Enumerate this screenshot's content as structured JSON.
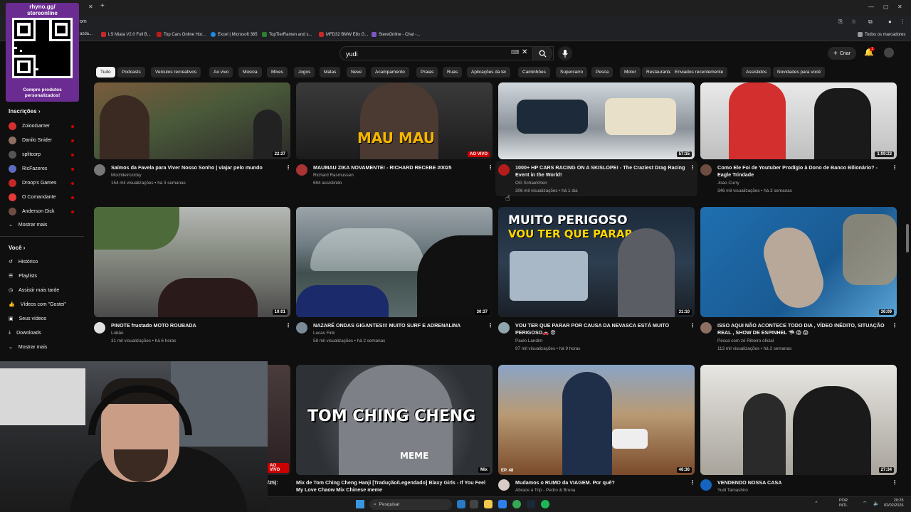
{
  "promo": {
    "line1": "rhyno.gg/",
    "line2": "stereonline",
    "cta": "Compre produtos personalizados!"
  },
  "browser": {
    "url_fragment": "om",
    "bookmarks": [
      "azda...",
      "LS Miata V2.0 Full B...",
      "Top Cars Online Hor...",
      "Excel | Microsoft 365",
      "TopTierRamen and s...",
      "MFD32 BMW E8x G...",
      "StereOnline - Chat -..."
    ],
    "all_bookmarks": "Todos os marcadores"
  },
  "header": {
    "search_value": "yudi",
    "create_label": "Criar",
    "notification_count": "1"
  },
  "chips": [
    "Tudo",
    "Podcasts",
    "Veículos recreativos",
    "Ao vivo",
    "Música",
    "Mixes",
    "Jogos",
    "Malas",
    "Neve",
    "Acampamento",
    "Praias",
    "Ruas",
    "Aplicações da lei",
    "Caminhões",
    "Supercarro",
    "Pesca",
    "Motor",
    "Restaurantes",
    "Enviados recentemente",
    "Assistidos",
    "Novidades para você"
  ],
  "sidebar": {
    "subs_heading": "Inscrições",
    "subs": [
      "ZoiooGamer",
      "Danilo Snider",
      "splitcorp",
      "RicFazeres",
      "Droop's Games",
      "O Comandante",
      "Anderson Dick"
    ],
    "show_more": "Mostrar mais",
    "you_heading": "Você",
    "you_items": [
      "Histórico",
      "Playlists",
      "Assistir mais tarde",
      "Vídeos com \"Gostei\"",
      "Seus vídeos",
      "Downloads"
    ],
    "show_more_2": "Mostrar mais"
  },
  "videos": [
    {
      "title": "Saímos da Favela para Viver Nosso Sonho | viajar  pelo mundo",
      "channel": "Mochileirozicky",
      "meta": "154 mil visualizações • há 3 semanas",
      "duration": "22:27"
    },
    {
      "title": "MAUMAU ZIKA NOVAMENTE! - RICHARD RECEBE #0025",
      "channel": "Richard Rasmussen",
      "meta": "694 assistindo",
      "duration": "AO VIVO",
      "overlay": "MAU MAU"
    },
    {
      "title": "1000+ HP CARS RACING ON A SKISLOPE! - The Craziest Drag Racing Event in the World!",
      "channel": "OG Schaefchen",
      "meta": "306 mil visualizações • há 1 dia",
      "duration": "57:15"
    },
    {
      "title": "Como Ele Foi de Youtuber Prodígio à Dono de Banco Bilionário? - Eagle Trindade",
      "channel": "Joao Curry",
      "meta": "346 mil visualizações • há 3 semanas",
      "duration": "1:09:23"
    },
    {
      "title": "PINOTE frustado MOTO ROUBADA",
      "channel": "Lobão",
      "meta": "31 mil visualizações • há 6 horas",
      "duration": "10:01"
    },
    {
      "title": "NAZARÉ ONDAS GIGANTES!!! MUITO SURF E ADRENALINA",
      "channel": "Lucas Fink",
      "meta": "58 mil visualizações • há 2 semanas",
      "duration": "30:37"
    },
    {
      "title": "VOU TER QUE PARAR POR CAUSA DA NEVASCA ESTÁ MUITO PERIGOSO🚗 😨",
      "channel": "Paulo Landim",
      "meta": "97 mil visualizações • há 9 horas",
      "duration": "31:10",
      "overlay": "MUITO PERIGOSO",
      "overlay2": "VOU TER QUE PARAR"
    },
    {
      "title": "ISSO AQUI NÃO ACONTECE TODO DIA , VÍDEO INÉDITO, SITUAÇÃO REAL , SHOW DE ESPINHEL 🦈 😱 😱",
      "channel": "Pesca com zé Ribeiro oficial",
      "meta": "113 mil visualizações • há 2 semanas",
      "duration": "36:09"
    },
    {
      "title": "/25):",
      "channel": "",
      "meta": "",
      "duration": "AO VIVO"
    },
    {
      "title": "Mix de Tom Ching Cheng Hanji [Tradução/Legendado] Blaxy Girls - If You Feel My Love Chaow Mix Chinese meme",
      "channel": "",
      "meta": "",
      "duration": "Mix",
      "overlay": "TOM CHING CHENG",
      "overlay2": "MEME"
    },
    {
      "title": "Mudamos o RUMO da VIAGEM. Por quê?",
      "channel": "Abrace a Trip - Pedro & Bruna",
      "meta": "",
      "duration": "46:36",
      "badge": "EP. 48"
    },
    {
      "title": "VENDENDO NOSSA CASA",
      "channel": "Yudi Tamashiro",
      "meta": "",
      "duration": "27:34"
    }
  ],
  "taskbar": {
    "search": "Pesquisar",
    "lang1": "POR",
    "lang2": "INTL",
    "time": "20:25",
    "date": "02/02/2026"
  }
}
